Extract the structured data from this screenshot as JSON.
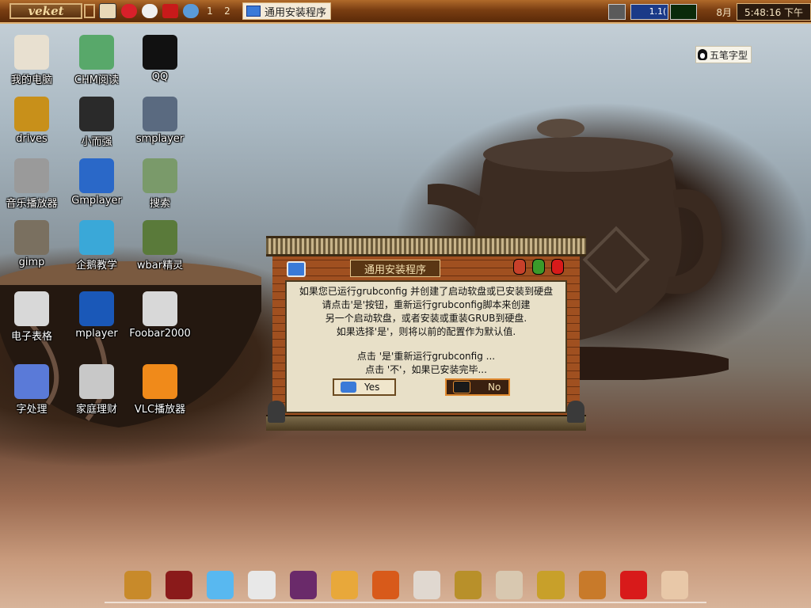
{
  "taskbar": {
    "start_label": "veket",
    "workspaces": [
      "1",
      "2"
    ],
    "task_item": "通用安装程序",
    "cpu_label": "1.1(",
    "date_label": "8月",
    "clock": "5:48:16 下午"
  },
  "ime": {
    "label": "五笔字型"
  },
  "desktop_icons": [
    {
      "label": "我的电脑",
      "icon": "computer-icon",
      "color": "#e8e0d0"
    },
    {
      "label": "CHM阅读",
      "icon": "chm-reader-icon",
      "color": "#58a86a"
    },
    {
      "label": "QQ",
      "icon": "qq-icon",
      "color": "#111111"
    },
    {
      "label": "drives",
      "icon": "drives-icon",
      "color": "#c8901a"
    },
    {
      "label": "小而强",
      "icon": "usb-drive-icon",
      "color": "#2a2a2a"
    },
    {
      "label": "smplayer",
      "icon": "smplayer-icon",
      "color": "#5a6a80"
    },
    {
      "label": "音乐播放器",
      "icon": "speaker-icon",
      "color": "#9a9a9a"
    },
    {
      "label": "Gmplayer",
      "icon": "gmplayer-icon",
      "color": "#2a68c8"
    },
    {
      "label": "搜索",
      "icon": "search-icon",
      "color": "#7a9a6a"
    },
    {
      "label": "gimp",
      "icon": "gimp-icon",
      "color": "#7a7060"
    },
    {
      "label": "企鹅教学",
      "icon": "penguin-teach-icon",
      "color": "#3aa8d8"
    },
    {
      "label": "wbar精灵",
      "icon": "wbar-icon",
      "color": "#5a7a3a"
    },
    {
      "label": "电子表格",
      "icon": "spreadsheet-icon",
      "color": "#d8d8d8"
    },
    {
      "label": "mplayer",
      "icon": "mplayer-icon",
      "color": "#1a58b8"
    },
    {
      "label": "Foobar2000",
      "icon": "foobar-icon",
      "color": "#d8d8d8"
    },
    {
      "label": "字处理",
      "icon": "word-processor-icon",
      "color": "#5a7ad8"
    },
    {
      "label": "家庭理财",
      "icon": "calculator-icon",
      "color": "#c8c8c8"
    },
    {
      "label": "VLC播放器",
      "icon": "vlc-icon",
      "color": "#f08a1a"
    }
  ],
  "dialog": {
    "title": "通用安装程序",
    "lines": [
      "如果您已运行grubconfig 并创建了启动软盘或已安装到硬盘",
      "请点击'是'按钮，重新运行grubconfig脚本来创建",
      "另一个启动软盘，或者安装或重装GRUB到硬盘.",
      "如果选择'是'，则将以前的配置作为默认值."
    ],
    "hint_lines": [
      "点击 '是'重新运行grubconfig ...",
      "点击 '不'，如果已安装完毕..."
    ],
    "yes_label": "Yes",
    "no_label": "No"
  },
  "dock_icons": [
    {
      "icon": "palace-icon",
      "color": "#c88a2a"
    },
    {
      "icon": "terminal-icon",
      "color": "#8a1a1a"
    },
    {
      "icon": "browser-icon",
      "color": "#58b8f0"
    },
    {
      "icon": "notes-icon",
      "color": "#e8e8e8"
    },
    {
      "icon": "media-icon",
      "color": "#6a2a6a"
    },
    {
      "icon": "painting-icon",
      "color": "#e8a83a"
    },
    {
      "icon": "fire-icon",
      "color": "#d85a1a"
    },
    {
      "icon": "editor-icon",
      "color": "#e0d8d0"
    },
    {
      "icon": "abacus-icon",
      "color": "#b8902a"
    },
    {
      "icon": "picture-icon",
      "color": "#d8c8b0"
    },
    {
      "icon": "treasure-icon",
      "color": "#c8a02a"
    },
    {
      "icon": "tea-icon",
      "color": "#c87a2a"
    },
    {
      "icon": "knot-icon",
      "color": "#d81a1a"
    },
    {
      "icon": "ink-icon",
      "color": "#e8c8a8"
    }
  ]
}
